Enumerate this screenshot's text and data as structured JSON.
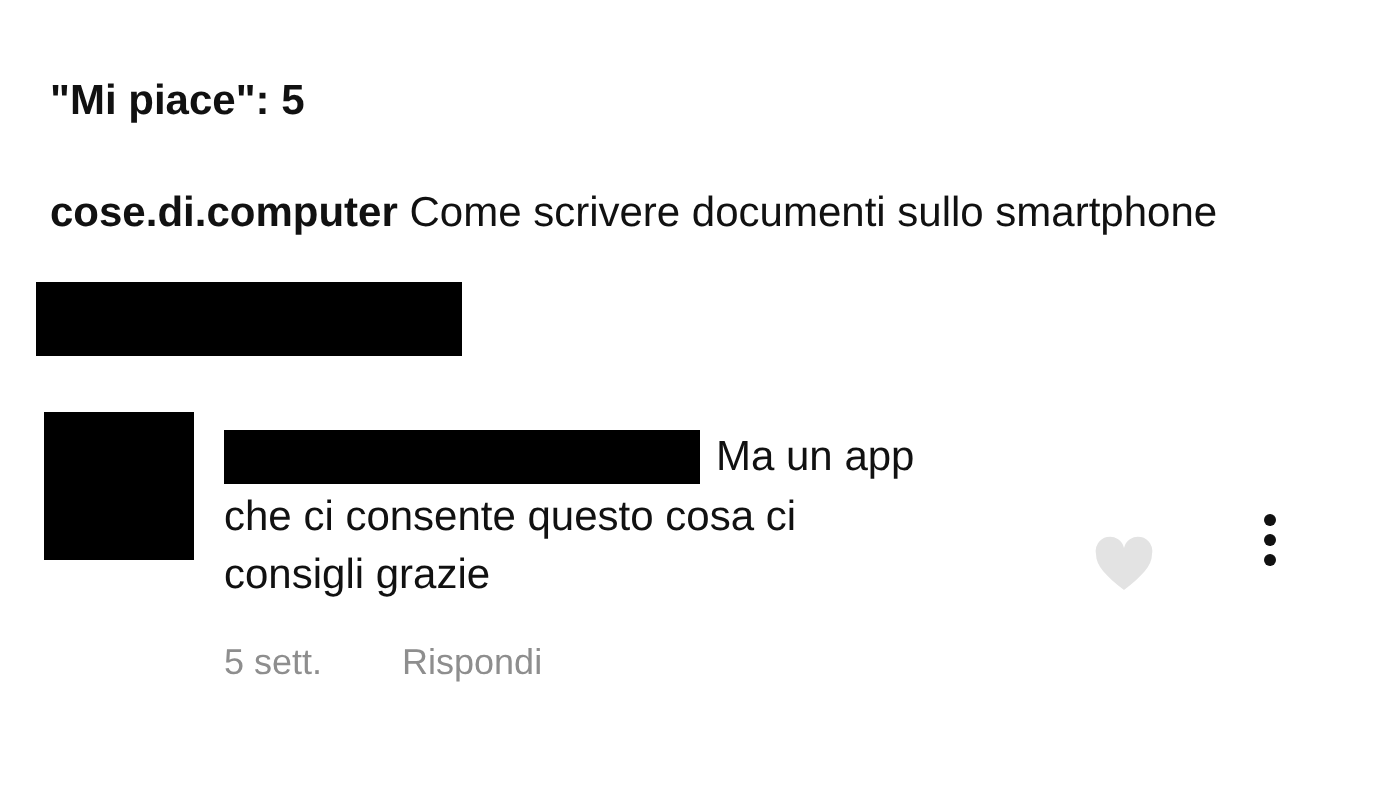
{
  "likes": "\"Mi piace\": 5",
  "caption": {
    "username": "cose.di.computer",
    "text": "Come scrivere documenti sullo smartphone"
  },
  "comment": {
    "text_first_line": "Ma un app",
    "text_rest": "che ci consente questo cosa ci consigli grazie",
    "time": "5 sett.",
    "reply": "Rispondi",
    "liked": false
  }
}
